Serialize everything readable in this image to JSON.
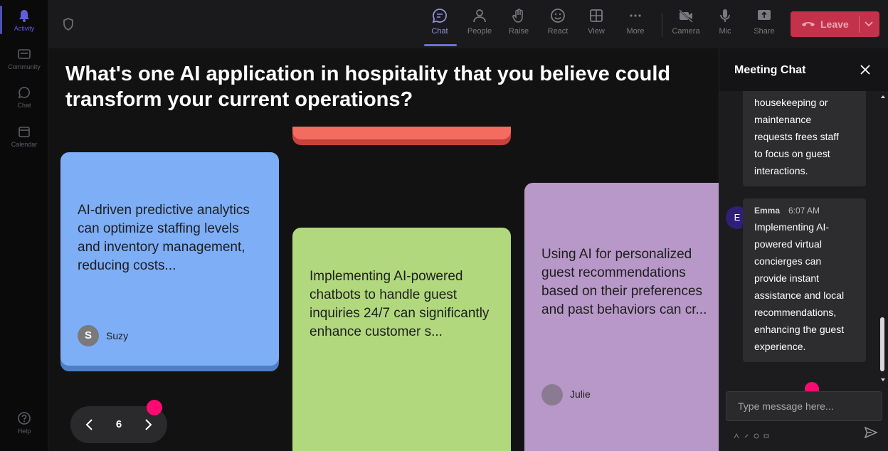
{
  "rail": {
    "items": [
      {
        "label": "Activity"
      },
      {
        "label": "Community"
      },
      {
        "label": "Chat"
      },
      {
        "label": "Calendar"
      },
      {
        "label": "Help"
      }
    ]
  },
  "toolbar": {
    "buttons": [
      {
        "label": "Chat",
        "icon": "chat-icon"
      },
      {
        "label": "People",
        "icon": "people-icon"
      },
      {
        "label": "Raise",
        "icon": "hand-icon"
      },
      {
        "label": "React",
        "icon": "smile-icon"
      },
      {
        "label": "View",
        "icon": "grid-icon"
      },
      {
        "label": "More",
        "icon": "more-icon"
      },
      {
        "label": "Camera",
        "icon": "camera-off-icon"
      },
      {
        "label": "Mic",
        "icon": "mic-icon"
      },
      {
        "label": "Share",
        "icon": "share-icon"
      }
    ],
    "leave_label": "Leave"
  },
  "stage": {
    "question": "What's one AI application in hospitality that you believe could transform your current operations?",
    "cards": [
      {
        "color": "#7eaef6",
        "text": "AI-driven predictive analytics can optimize staffing levels and inventory management, reducing costs...",
        "author": "Suzy",
        "initial": "S"
      },
      {
        "color": "#b1d87d",
        "text": "Implementing AI-powered chatbots to handle guest inquiries 24/7 can significantly enhance customer s..."
      },
      {
        "color": "#b898c8",
        "text": "Using AI for personalized guest recommendations based on their preferences and past behaviors can cr...",
        "author": "Julie"
      }
    ],
    "page_number": "6"
  },
  "chat": {
    "title": "Meeting Chat",
    "messages": [
      {
        "text_lines": [
          "housekeeping or",
          "maintenance",
          "requests frees staff",
          "to focus on guest",
          "interactions."
        ]
      },
      {
        "author": "Emma",
        "initial": "E",
        "time": "6:07 AM",
        "text_lines": [
          "Implementing AI-",
          "powered virtual",
          "concierges can",
          "provide instant",
          "assistance and local",
          "recommendations,",
          "enhancing the guest",
          "experience."
        ]
      }
    ],
    "input_placeholder": "Type message here..."
  },
  "colors": {
    "accent": "#6f70d0",
    "leave": "#c4314b",
    "marker": "#ff0a72"
  }
}
